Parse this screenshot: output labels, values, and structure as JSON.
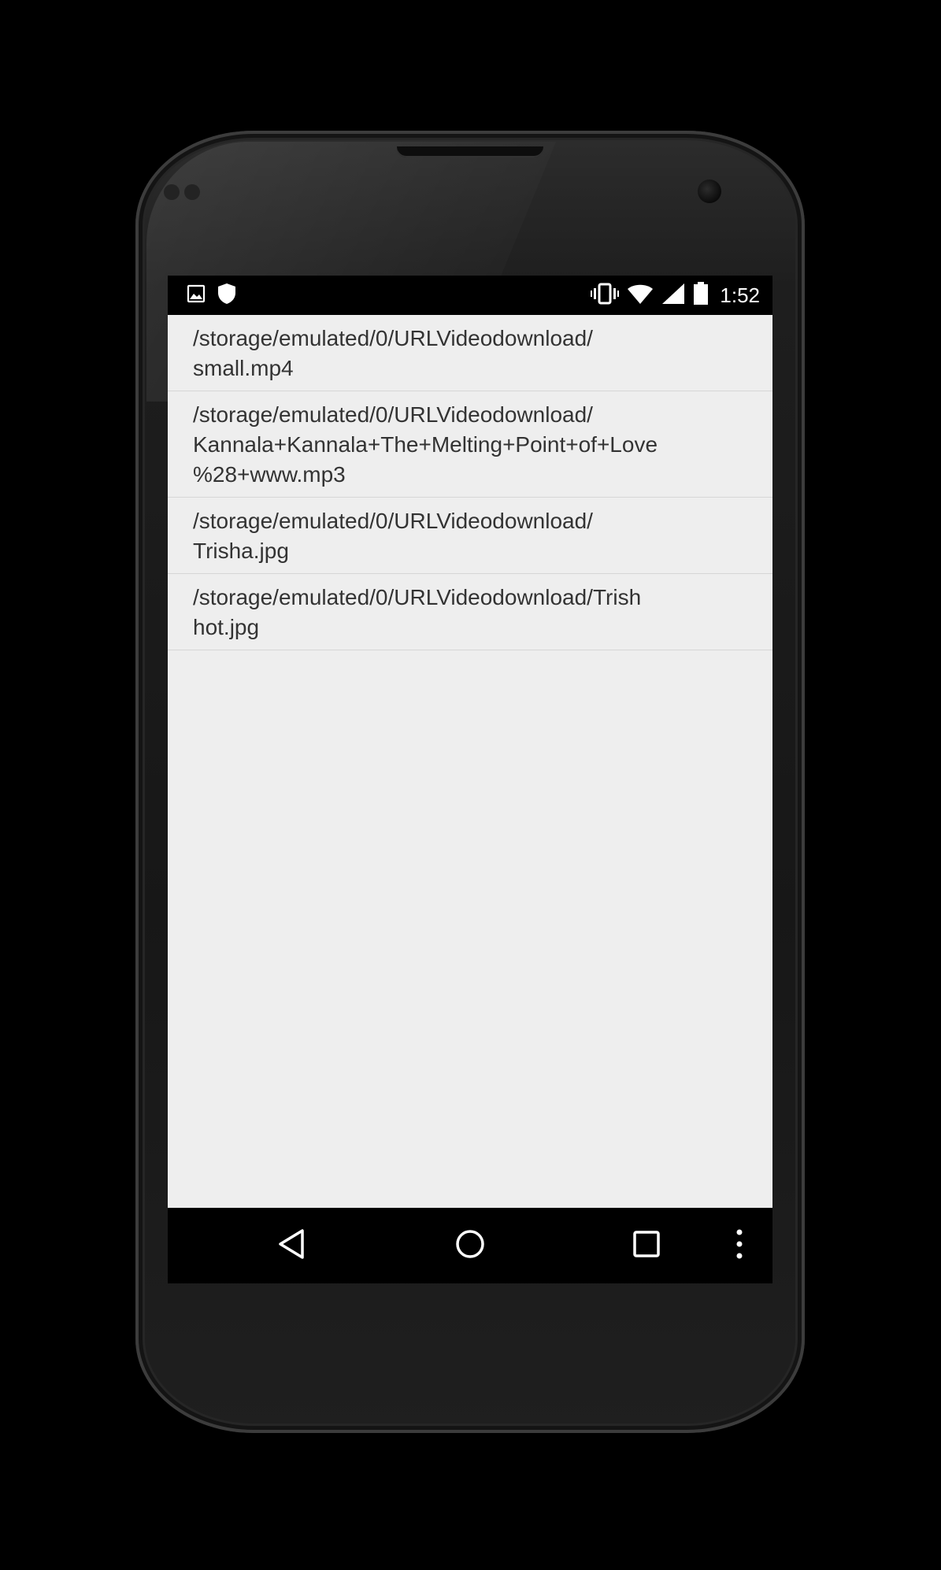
{
  "status_bar": {
    "time": "1:52",
    "left_icons": [
      "image-notification-icon",
      "shield-icon"
    ],
    "right_icons": [
      "vibrate-icon",
      "wifi-icon",
      "signal-icon",
      "battery-icon"
    ]
  },
  "files": [
    {
      "path": "/storage/emulated/0/URLVideodownload/\nsmall.mp4"
    },
    {
      "path": "/storage/emulated/0/URLVideodownload/\nKannala+Kannala+The+Melting+Point+of+Love\n%28+www.mp3"
    },
    {
      "path": "/storage/emulated/0/URLVideodownload/\nTrisha.jpg"
    },
    {
      "path": "/storage/emulated/0/URLVideodownload/Trish\nhot.jpg"
    }
  ],
  "nav_bar": {
    "icons": [
      "back-icon",
      "home-icon",
      "recents-icon",
      "overflow-menu-icon"
    ]
  },
  "colors": {
    "screen_background": "#eeeeee",
    "text": "#333333",
    "divider": "#d6d6d6",
    "system_bars": "#000000"
  }
}
